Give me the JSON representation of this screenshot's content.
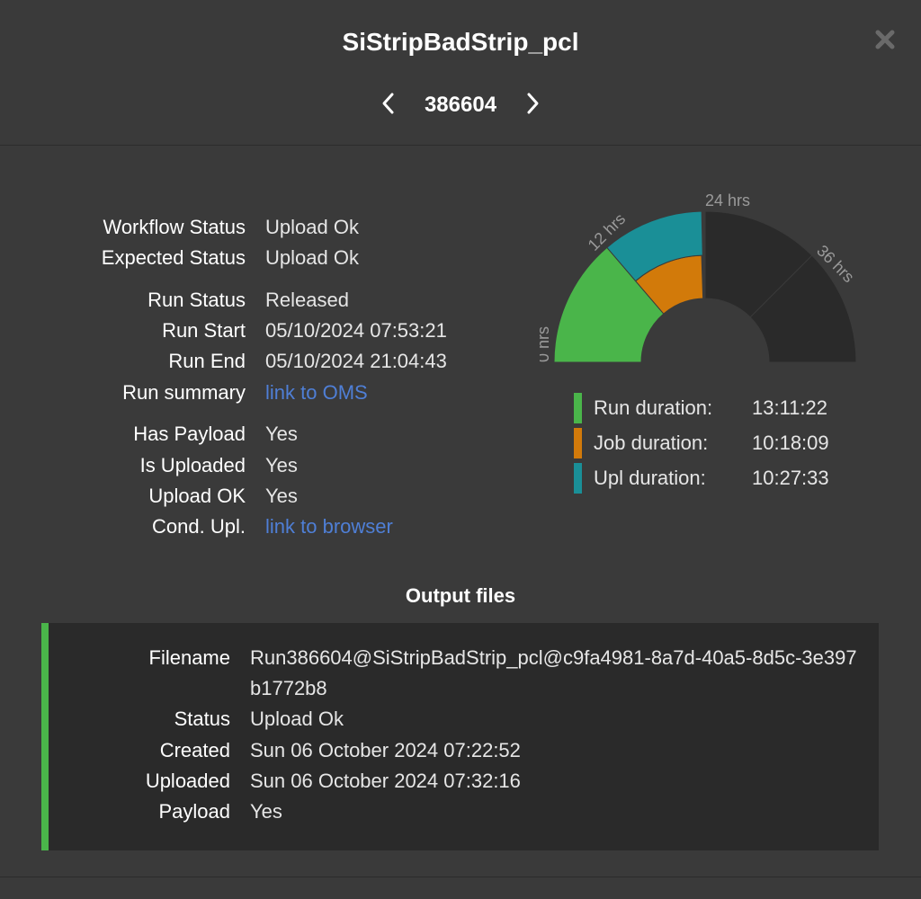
{
  "title": "SiStripBadStrip_pcl",
  "run_number": "386604",
  "info_groups": [
    [
      {
        "label": "Workflow Status",
        "value": "Upload Ok"
      },
      {
        "label": "Expected Status",
        "value": "Upload Ok"
      }
    ],
    [
      {
        "label": "Run Status",
        "value": "Released"
      },
      {
        "label": "Run Start",
        "value": "05/10/2024 07:53:21"
      },
      {
        "label": "Run End",
        "value": "05/10/2024 21:04:43"
      },
      {
        "label": "Run summary",
        "value": "link to OMS",
        "link": true
      }
    ],
    [
      {
        "label": "Has Payload",
        "value": "Yes"
      },
      {
        "label": "Is Uploaded",
        "value": "Yes"
      },
      {
        "label": "Upload OK",
        "value": "Yes"
      },
      {
        "label": "Cond. Upl.",
        "value": "link to browser",
        "link": true
      }
    ]
  ],
  "chart_data": {
    "type": "radial-bar",
    "ticks": [
      "0 hrs",
      "12 hrs",
      "24 hrs",
      "36 hrs"
    ],
    "max_hours": 48,
    "series": [
      {
        "name": "Run duration",
        "hours": 13.189,
        "color": "#4ab54a"
      },
      {
        "name": "Job duration",
        "hours": 10.303,
        "color": "#d27a0a"
      },
      {
        "name": "Upl duration",
        "hours": 10.459,
        "color": "#1a8f97"
      }
    ],
    "background_color": "#2a2a2a"
  },
  "legend": [
    {
      "label": "Run duration:",
      "value": "13:11:22",
      "color": "#4ab54a"
    },
    {
      "label": "Job duration:",
      "value": "10:18:09",
      "color": "#d27a0a"
    },
    {
      "label": "Upl duration:",
      "value": "10:27:33",
      "color": "#1a8f97"
    }
  ],
  "output_title": "Output files",
  "output_file": [
    {
      "label": "Filename",
      "value": "Run386604@SiStripBadStrip_pcl@c9fa4981-8a7d-40a5-8d5c-3e397b1772b8"
    },
    {
      "label": "Status",
      "value": "Upload Ok"
    },
    {
      "label": "Created",
      "value": "Sun 06 October 2024 07:22:52"
    },
    {
      "label": "Uploaded",
      "value": "Sun 06 October 2024 07:32:16"
    },
    {
      "label": "Payload",
      "value": "Yes"
    }
  ],
  "colors": {
    "background": "#3a3a3a",
    "panel": "#2a2a2a",
    "link": "#4f7fd6",
    "accent_green": "#4ab54a"
  },
  "icons": {
    "close": "close-icon",
    "prev": "chevron-left-icon",
    "next": "chevron-right-icon"
  }
}
